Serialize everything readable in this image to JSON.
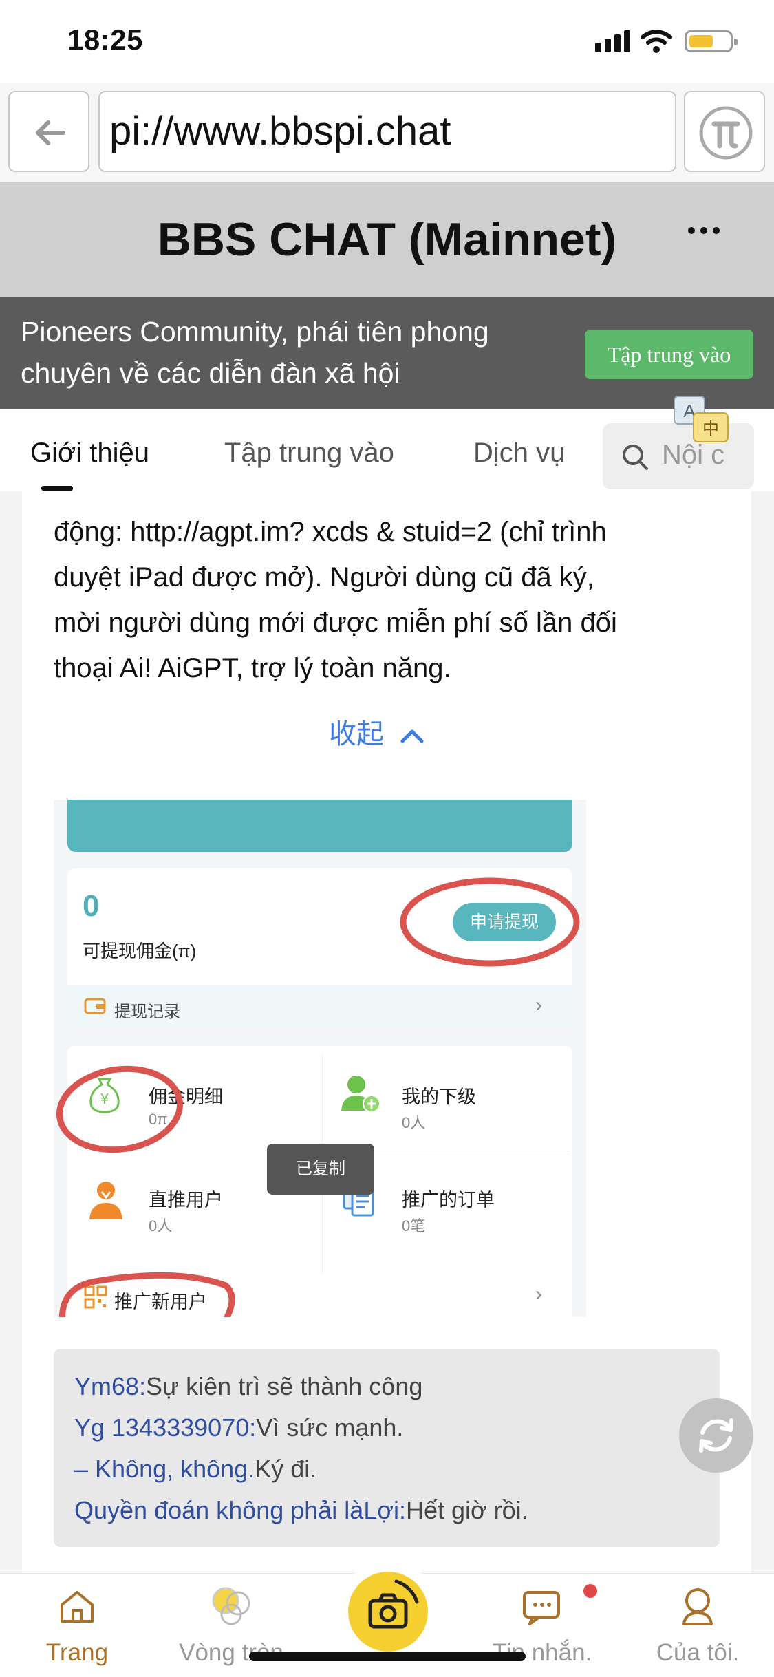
{
  "status_bar": {
    "time": "18:25"
  },
  "browser": {
    "url": "pi://www.bbspi.chat"
  },
  "header": {
    "title": "BBS CHAT (Mainnet)"
  },
  "banner": {
    "line1": "Pioneers Community, phái tiên phong",
    "line2": "chuyên về các diễn đàn xã hội",
    "follow_label": "Tập trung vào"
  },
  "tabs": [
    {
      "label": "Giới thiệu"
    },
    {
      "label": "Tập trung vào"
    },
    {
      "label": "Dịch vụ"
    }
  ],
  "search": {
    "placeholder": "Nội c"
  },
  "content": {
    "paragraph_lines": [
      "động: http://agpt.im? xcds & stuid=2 (chỉ trình",
      "duyệt iPad được mở). Người dùng cũ đã ký,",
      "mời người dùng mới được miễn phí số lần đối",
      "thoại Ai! AiGPT, trợ lý toàn năng."
    ],
    "collapse_label": "收起"
  },
  "embedded": {
    "balance": "0",
    "withdrawable_label": "可提现佣金(π)",
    "apply_button": "申请提现",
    "record_label": "提现记录",
    "grid": [
      {
        "title": "佣金明细",
        "sub": "0π"
      },
      {
        "title": "我的下级",
        "sub": "0人"
      },
      {
        "title": "直推用户",
        "sub": "0人"
      },
      {
        "title": "推广的订单",
        "sub": "0笔"
      }
    ],
    "toast": "已复制",
    "promo_label": "推广新用户"
  },
  "comments": [
    {
      "user": "Ym68:",
      "text": "Sự kiên trì sẽ thành công"
    },
    {
      "user": "Yg 1343339070:",
      "text": "Vì sức mạnh."
    },
    {
      "user": "– Không, không.",
      "text": "Ký đi."
    },
    {
      "user": "Quyền đoán không phải làLợi:",
      "text": "Hết giờ rồi."
    }
  ],
  "bottom_nav": [
    {
      "label": "Trang",
      "icon": "home-icon"
    },
    {
      "label": "Vòng tròn",
      "icon": "circles-icon"
    },
    {
      "label": "Tin nhắn.",
      "icon": "message-icon"
    },
    {
      "label": "Của tôi.",
      "icon": "profile-icon"
    }
  ],
  "colors": {
    "accent_green": "#5cb86a",
    "active_nav": "#a9712a",
    "link_blue": "#3f7be0",
    "teal": "#57b6be"
  }
}
